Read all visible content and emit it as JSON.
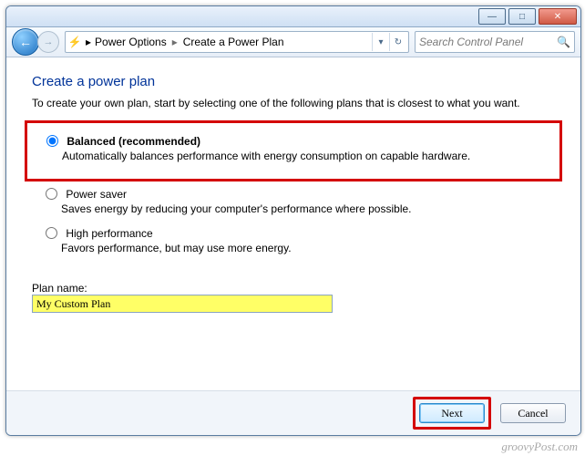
{
  "window": {
    "minimize": "—",
    "maximize": "□",
    "close": "✕"
  },
  "nav": {
    "back": "←",
    "forward": "→"
  },
  "address": {
    "icon": "⚡",
    "crumbs": [
      "Power Options",
      "Create a Power Plan"
    ],
    "sep": "▸",
    "dropdown": "▾",
    "refresh": "↻"
  },
  "search": {
    "placeholder": "Search Control Panel",
    "icon": "🔍"
  },
  "page": {
    "title": "Create a power plan",
    "intro": "To create your own plan, start by selecting one of the following plans that is closest to what you want."
  },
  "options": {
    "balanced": {
      "title": "Balanced (recommended)",
      "desc": "Automatically balances performance with energy consumption on capable hardware."
    },
    "powersaver": {
      "title": "Power saver",
      "desc": "Saves energy by reducing your computer's performance where possible."
    },
    "highperf": {
      "title": "High performance",
      "desc": "Favors performance, but may use more energy."
    }
  },
  "plan": {
    "label": "Plan name:",
    "value": "My Custom Plan"
  },
  "buttons": {
    "next": "Next",
    "cancel": "Cancel"
  },
  "watermark": "groovyPost.com"
}
